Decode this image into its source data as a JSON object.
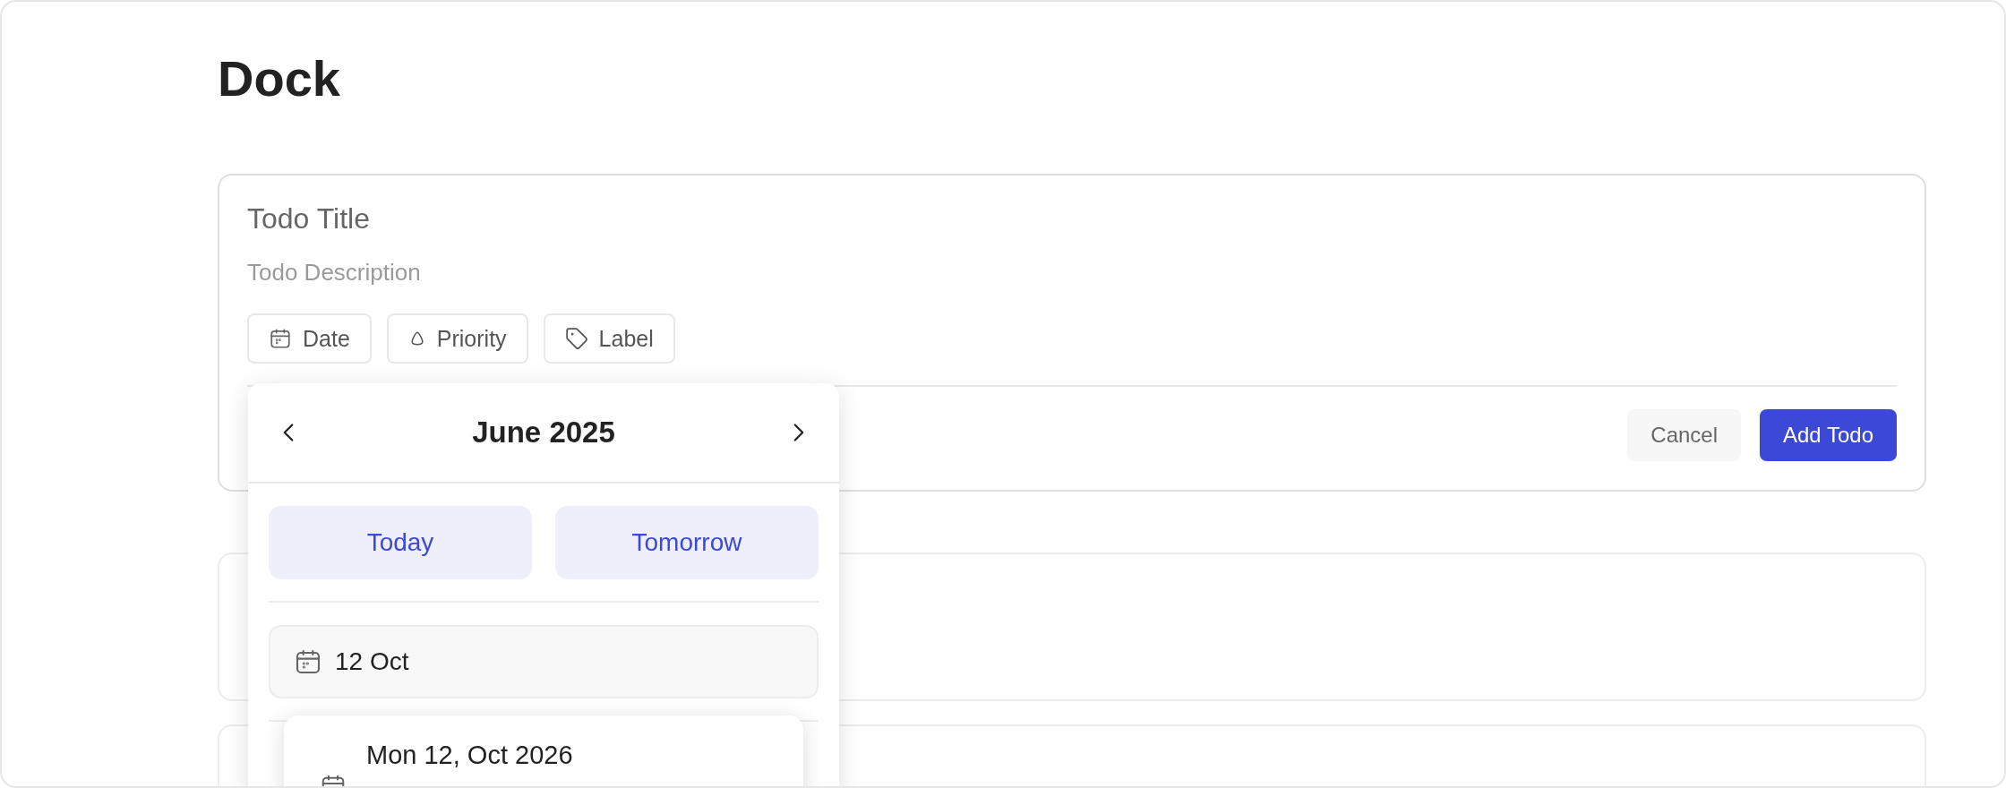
{
  "page": {
    "title": "Dock"
  },
  "form": {
    "title": {
      "placeholder": "Todo Title"
    },
    "description": {
      "placeholder": "Todo Description"
    },
    "chips": [
      {
        "kind": "date",
        "label": "Date"
      },
      {
        "kind": "priority",
        "label": "Priority"
      },
      {
        "kind": "label",
        "label": "Label"
      }
    ],
    "buttons": [
      {
        "kind": "secondary",
        "label": "Cancel"
      },
      {
        "kind": "primary",
        "label": "Add Todo"
      }
    ]
  },
  "date_picker": {
    "month": "June 2025",
    "quick_picks": [
      {
        "label": "Today"
      },
      {
        "label": "Tomorrow"
      }
    ],
    "date_input": {
      "value": "12 Oct"
    },
    "suggestion": {
      "text": "Mon 12, Oct 2026"
    }
  },
  "todo_cards": [
    {
      "kind": "card"
    },
    {
      "kind": "card"
    }
  ]
}
